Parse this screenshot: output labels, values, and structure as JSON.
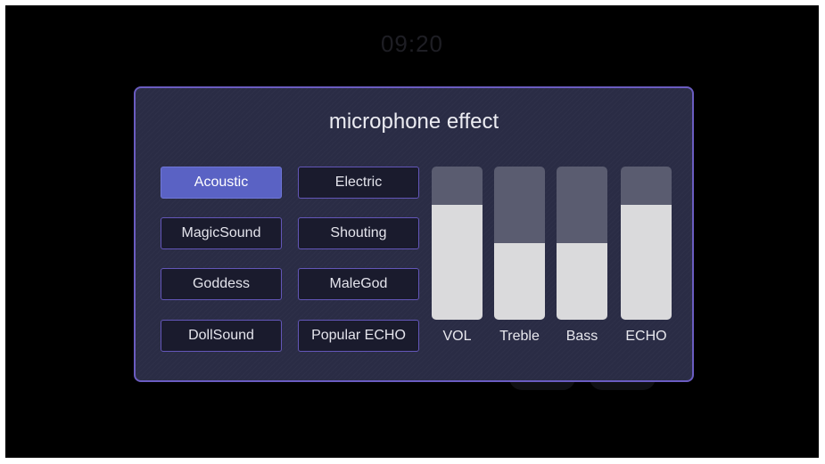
{
  "clock": {
    "time": "09:20"
  },
  "dialog": {
    "title": "microphone effect",
    "presets": [
      {
        "label": "Acoustic",
        "selected": true
      },
      {
        "label": "Electric",
        "selected": false
      },
      {
        "label": "MagicSound",
        "selected": false
      },
      {
        "label": "Shouting",
        "selected": false
      },
      {
        "label": "Goddess",
        "selected": false
      },
      {
        "label": "MaleGod",
        "selected": false
      },
      {
        "label": "DollSound",
        "selected": false
      },
      {
        "label": "Popular ECHO",
        "selected": false
      }
    ],
    "sliders": [
      {
        "label": "VOL",
        "level_percent": 75
      },
      {
        "label": "Treble",
        "level_percent": 50
      },
      {
        "label": "Bass",
        "level_percent": 50
      },
      {
        "label": "ECHO",
        "level_percent": 75
      }
    ]
  },
  "colors": {
    "panel_background": "#2a2c45",
    "panel_border": "#6a5cc0",
    "selected_preset": "#5a62c4",
    "slider_track": "#5a5c70",
    "slider_fill": "#dadadc"
  }
}
